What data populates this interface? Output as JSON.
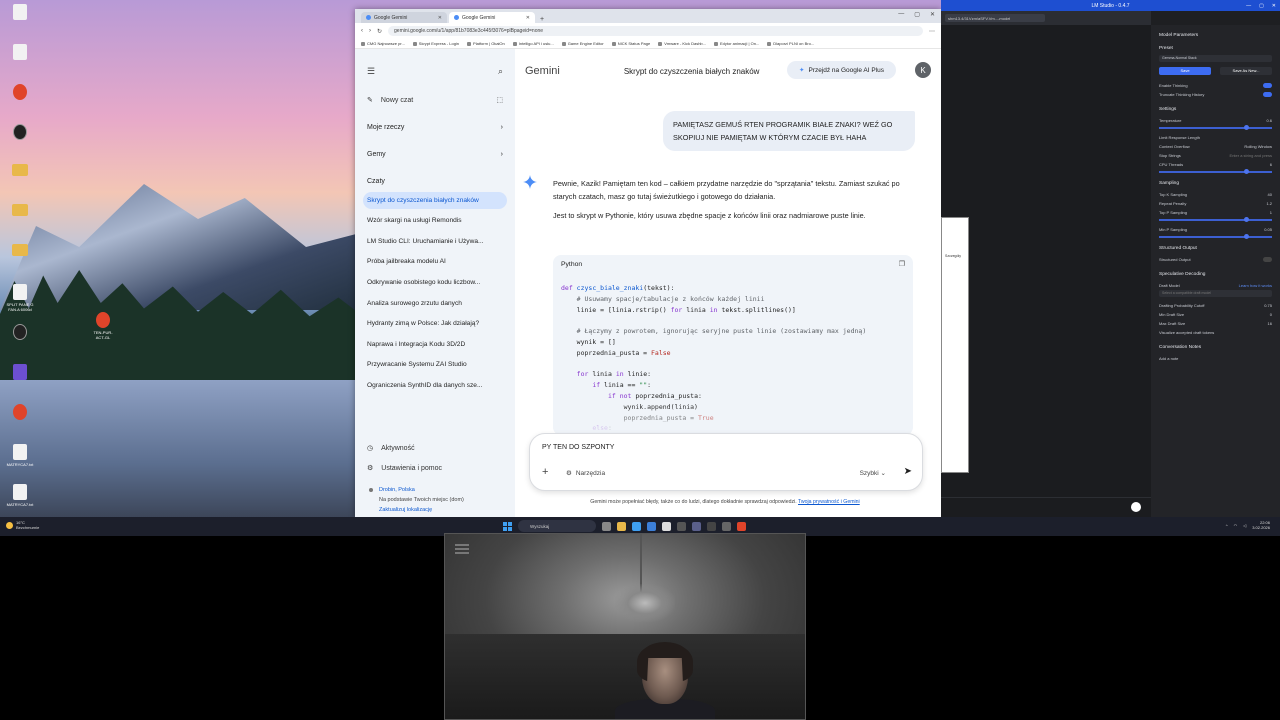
{
  "desktop": {
    "icons": [
      {
        "label": "",
        "kind": "doc"
      },
      {
        "label": "",
        "kind": "doc"
      },
      {
        "label": "",
        "kind": "brave"
      },
      {
        "label": "",
        "kind": "circle"
      },
      {
        "label": "",
        "kind": "folder"
      },
      {
        "label": "",
        "kind": "folder"
      },
      {
        "label": "",
        "kind": "folder"
      },
      {
        "label": "SPLIT PANE G FAN.A 6006d",
        "kind": "doc"
      },
      {
        "label": "",
        "kind": "circle"
      },
      {
        "label": "",
        "kind": "purple"
      },
      {
        "label": "",
        "kind": "brave"
      },
      {
        "label": "MATRYCA7.txt",
        "kind": "doc"
      },
      {
        "label": "MATRYCA7.txt",
        "kind": "doc"
      }
    ],
    "extra_icon_label": "TEN-PUR-ACT-GL"
  },
  "chrome": {
    "tabs": [
      {
        "title": "Google Gemini",
        "active": false
      },
      {
        "title": "Google Gemini",
        "active": true
      }
    ],
    "url": "gemini.google.com/u/1/app/81b7083e3c445f3076=plBpageid=none",
    "bookmarks": [
      "CMG Najnowsze pr...",
      "Skrypt Express - Login",
      "Platform | OkaiOn",
      "Intelligo API i usłu...",
      "Game Engine Editor",
      "NICK Status Page",
      "Vmware - Kick Dashb...",
      "Edytor animacji | On...",
      "Dlaporzi PLNI on Bro..."
    ]
  },
  "gemini": {
    "brand": "Gemini",
    "conversation_title": "Skrypt do czyszczenia białych znaków",
    "upgrade_label": "Przejdź na Google AI Plus",
    "avatar_letter": "K",
    "sidebar": {
      "new_chat": "Nowy czat",
      "my_stuff": "Moje rzeczy",
      "gems": "Gemy",
      "chats_heading": "Czaty",
      "chats": [
        "Skrypt do czyszczenia białych znaków",
        "Wzór skargi na usługi Remondis",
        "LM Studio CLI: Uruchamianie i Używa...",
        "Próba jailbreaka modelu AI",
        "Odkrywanie osobistego kodu liczbow...",
        "Analiza surowego zrzutu danych",
        "Hydranty zimą w Polsce: Jak działają?",
        "Naprawa i Integracja Kodu 3D/2D",
        "Przywracanie Systemu ZAI Studio",
        "Ograniczenia SynthID dla danych sze..."
      ],
      "activity": "Aktywność",
      "settings": "Ustawienia i pomoc",
      "location_place": "Drobin, Polska",
      "location_desc": "Na podstawie Twoich miejsc (dom)",
      "location_link": "Zaktualizuj lokalizację"
    },
    "user_message": "PAMIĘTASZ GEMUŚ RTEN PROGRAMIK BIAŁE ZNAKI? WEŹ GO SKOPIUJ NIE PAMIĘTAM W KTÓRYM CZACIE BYŁ HAHA",
    "answer_p1": "Pewnie, Kazik! Pamiętam ten kod – całkiem przydatne narzędzie do \"sprzątania\" tekstu. Zamiast szukać po starych czatach, masz go tutaj świeżutkiego i gotowego do działania.",
    "answer_p2": "Jest to skrypt w Pythonie, który usuwa zbędne spacje z końców linii oraz nadmiarowe puste linie.",
    "code_language": "Python",
    "code_lines": [
      "def czysc_biale_znaki(tekst):",
      "    # Usuwamy spacje/tabulacje z końców każdej linii",
      "    linie = [linia.rstrip() for linia in tekst.splitlines()]",
      "",
      "    # Łączymy z powrotem, ignorując seryjne puste linie (zostawiamy max jedną)",
      "    wynik = []",
      "    poprzednia_pusta = False",
      "",
      "    for linia in linie:",
      "        if linia == \"\":",
      "            if not poprzednia_pusta:",
      "                wynik.append(linia)",
      "                poprzednia_pusta = True",
      "        else:"
    ],
    "composer_text": "PY TEN DO SZPONTY",
    "tools_label": "Narzędzia",
    "mode_label": "Szybki",
    "disclaimer": "Gemini może popełniać błędy, także co do ludzi, dlatego dokładnie sprawdzaj odpowiedzi.",
    "disclaimer_link": "Twoja prywatność i Gemini"
  },
  "lmstudio": {
    "title": "LM Studio - 0.4.7",
    "panel_title": "Model Parameters",
    "preset_label": "Preset",
    "preset_value": "Gemma-Normal Stack",
    "save_label": "Save",
    "save_as_label": "Save As New...",
    "enable_thinking": "Enable Thinking",
    "truncate_history": "Truncate Thinking History",
    "settings_heading": "Settings",
    "temperature_label": "Temperature",
    "temperature_value": "0.6",
    "limit_response": "Limit Response Length",
    "context_overflow": "Context Overflow",
    "context_overflow_value": "Rolling Window",
    "stop_strings": "Stop Strings",
    "stop_placeholder": "Enter a string and press",
    "cpu_threads": "CPU Threads",
    "cpu_threads_value": "6",
    "sampling_heading": "Sampling",
    "topk_label": "Top K Sampling",
    "topk_value": "40",
    "repeat_label": "Repeat Penalty",
    "repeat_value": "1.2",
    "topp_label": "Top P Sampling",
    "topp_value": "1",
    "minp_label": "Min P Sampling",
    "minp_value": "0.05",
    "structured_heading": "Structured Output",
    "structured_label": "Structured Output",
    "spec_heading": "Speculative Decoding",
    "draft_model": "Draft Model",
    "draft_link": "Learn how it works",
    "draft_placeholder": "Select a compatible draft model",
    "drafting_prob": "Drafting Probability Cutoff",
    "drafting_prob_value": "0.75",
    "min_draft": "Min Draft Size",
    "min_draft_value": "0",
    "max_draft": "Max Draft Size",
    "max_draft_value": "16",
    "visualize_draft": "Visualize accepted draft tokens",
    "conv_notes": "Conversation Notes",
    "add_note": "Add a note",
    "tab_label": "shm13.4/31Vzm/aSFV.Vm...-model",
    "popup_label": "Szczegóły"
  },
  "taskbar": {
    "weather_temp": "16°C",
    "weather_desc": "Bezchmurnie",
    "search_placeholder": "Wyszukaj",
    "time": "22:06",
    "date": "3.02.2026"
  }
}
